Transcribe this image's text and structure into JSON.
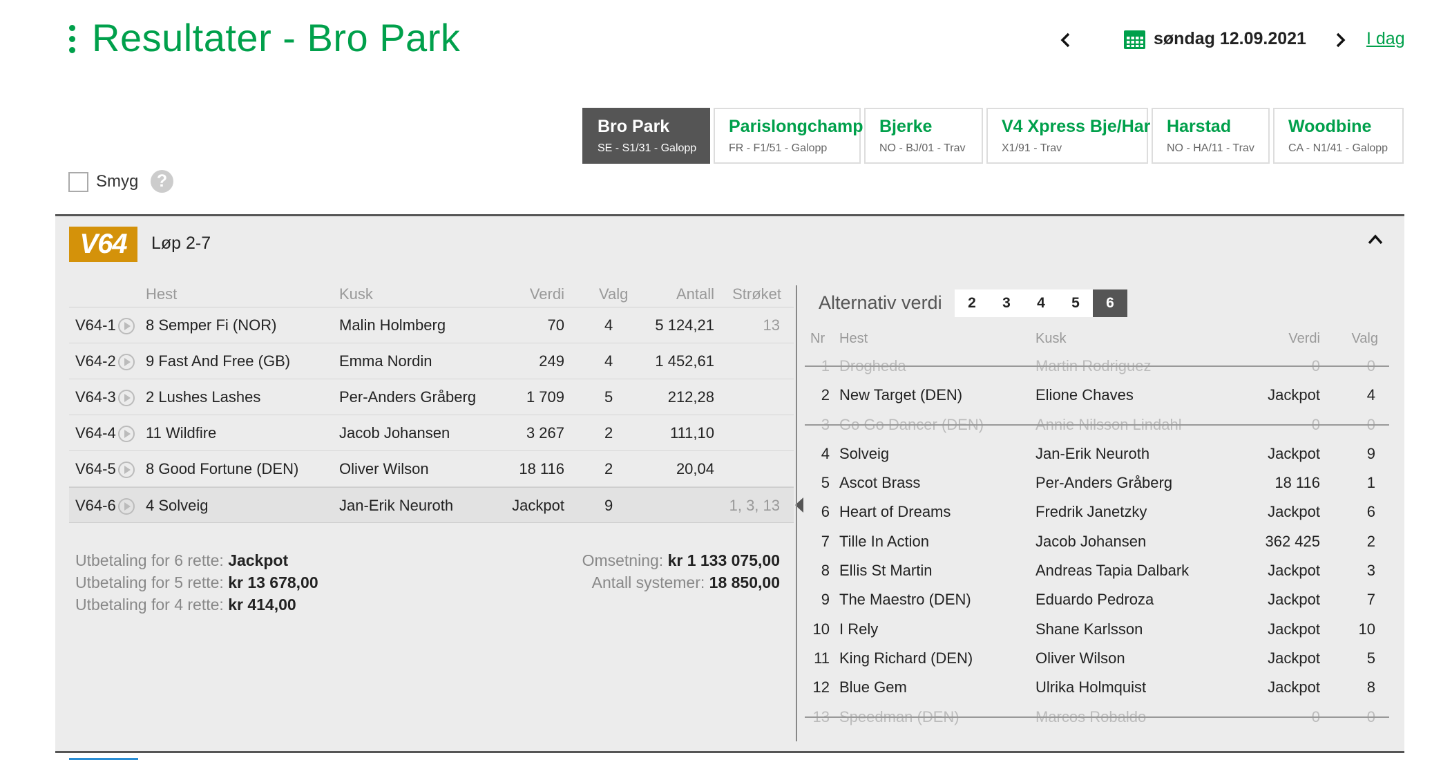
{
  "header": {
    "title": "Resultater - Bro Park",
    "date": "søndag 12.09.2021",
    "today_link": "I dag",
    "prev_icon": "chevron-left-icon",
    "next_icon": "chevron-right-icon"
  },
  "tracks": [
    {
      "name": "Bro Park",
      "sub": "SE - S1/31 - Galopp",
      "active": true
    },
    {
      "name": "Parislongchamp",
      "sub": "FR - F1/51 - Galopp"
    },
    {
      "name": "Bjerke",
      "sub": "NO - BJ/01 - Trav"
    },
    {
      "name": "V4 Xpress Bje/Har",
      "sub": "X1/91 - Trav"
    },
    {
      "name": "Harstad",
      "sub": "NO - HA/11 - Trav"
    },
    {
      "name": "Woodbine",
      "sub": "CA - N1/41 - Galopp"
    }
  ],
  "smyg": {
    "label": "Smyg",
    "help": "?"
  },
  "game": {
    "badge": "V64",
    "races": "Løp 2-7"
  },
  "left_table": {
    "headers": {
      "hest": "Hest",
      "kusk": "Kusk",
      "verdi": "Verdi",
      "valg": "Valg",
      "antall": "Antall",
      "stroket": "Strøket"
    },
    "rows": [
      {
        "id": "V64-1",
        "hest": "8 Semper Fi (NOR)",
        "kusk": "Malin Holmberg",
        "verdi": "70",
        "valg": "4",
        "antall": "5 124,21",
        "stroket": "13"
      },
      {
        "id": "V64-2",
        "hest": "9 Fast And Free (GB)",
        "kusk": "Emma Nordin",
        "verdi": "249",
        "valg": "4",
        "antall": "1 452,61",
        "stroket": ""
      },
      {
        "id": "V64-3",
        "hest": "2 Lushes Lashes",
        "kusk": "Per-Anders Gråberg",
        "verdi": "1 709",
        "valg": "5",
        "antall": "212,28",
        "stroket": ""
      },
      {
        "id": "V64-4",
        "hest": "11 Wildfire",
        "kusk": "Jacob Johansen",
        "verdi": "3 267",
        "valg": "2",
        "antall": "111,10",
        "stroket": ""
      },
      {
        "id": "V64-5",
        "hest": "8 Good Fortune (DEN)",
        "kusk": "Oliver Wilson",
        "verdi": "18 116",
        "valg": "2",
        "antall": "20,04",
        "stroket": ""
      },
      {
        "id": "V64-6",
        "hest": "4 Solveig",
        "kusk": "Jan-Erik Neuroth",
        "verdi": "Jackpot",
        "valg": "9",
        "antall": "",
        "stroket": "1, 3, 13"
      }
    ]
  },
  "payouts": {
    "p6_label": "Utbetaling for 6 rette:",
    "p6": "Jackpot",
    "p5_label": "Utbetaling for 5 rette:",
    "p5": "kr 13 678,00",
    "p4_label": "Utbetaling for 4 rette:",
    "p4": "kr 414,00",
    "oms_label": "Omsetning:",
    "oms": "kr 1 133 075,00",
    "sys_label": "Antall systemer:",
    "sys": "18 850,00"
  },
  "alt": {
    "title": "Alternativ verdi",
    "buttons": [
      "2",
      "3",
      "4",
      "5",
      "6"
    ],
    "selected": "6",
    "headers": {
      "nr": "Nr",
      "hest": "Hest",
      "kusk": "Kusk",
      "verdi": "Verdi",
      "valg": "Valg"
    },
    "rows": [
      {
        "nr": "1",
        "hest": "Drogheda",
        "kusk": "Martin Rodriguez",
        "verdi": "0",
        "valg": "0",
        "scratched": true
      },
      {
        "nr": "2",
        "hest": "New Target (DEN)",
        "kusk": "Elione Chaves",
        "verdi": "Jackpot",
        "valg": "4"
      },
      {
        "nr": "3",
        "hest": "Go Go Dancer (DEN)",
        "kusk": "Annie Nilsson Lindahl",
        "verdi": "0",
        "valg": "0",
        "scratched": true
      },
      {
        "nr": "4",
        "hest": "Solveig",
        "kusk": "Jan-Erik Neuroth",
        "verdi": "Jackpot",
        "valg": "9"
      },
      {
        "nr": "5",
        "hest": "Ascot Brass",
        "kusk": "Per-Anders Gråberg",
        "verdi": "18 116",
        "valg": "1"
      },
      {
        "nr": "6",
        "hest": "Heart of Dreams",
        "kusk": "Fredrik Janetzky",
        "verdi": "Jackpot",
        "valg": "6"
      },
      {
        "nr": "7",
        "hest": "Tille In Action",
        "kusk": "Jacob Johansen",
        "verdi": "362 425",
        "valg": "2"
      },
      {
        "nr": "8",
        "hest": "Ellis St Martin",
        "kusk": "Andreas Tapia Dalbark",
        "verdi": "Jackpot",
        "valg": "3"
      },
      {
        "nr": "9",
        "hest": "The Maestro (DEN)",
        "kusk": "Eduardo Pedroza",
        "verdi": "Jackpot",
        "valg": "7"
      },
      {
        "nr": "10",
        "hest": "I Rely",
        "kusk": "Shane Karlsson",
        "verdi": "Jackpot",
        "valg": "10"
      },
      {
        "nr": "11",
        "hest": "King Richard (DEN)",
        "kusk": "Oliver Wilson",
        "verdi": "Jackpot",
        "valg": "5"
      },
      {
        "nr": "12",
        "hest": "Blue Gem",
        "kusk": "Ulrika Holmquist",
        "verdi": "Jackpot",
        "valg": "8"
      },
      {
        "nr": "13",
        "hest": "Speedman (DEN)",
        "kusk": "Marcos Robaldo",
        "verdi": "0",
        "valg": "0",
        "scratched": true
      }
    ]
  },
  "colors": {
    "brand": "#00a04b",
    "v64": "#d4920a",
    "active_tab": "#555555"
  }
}
